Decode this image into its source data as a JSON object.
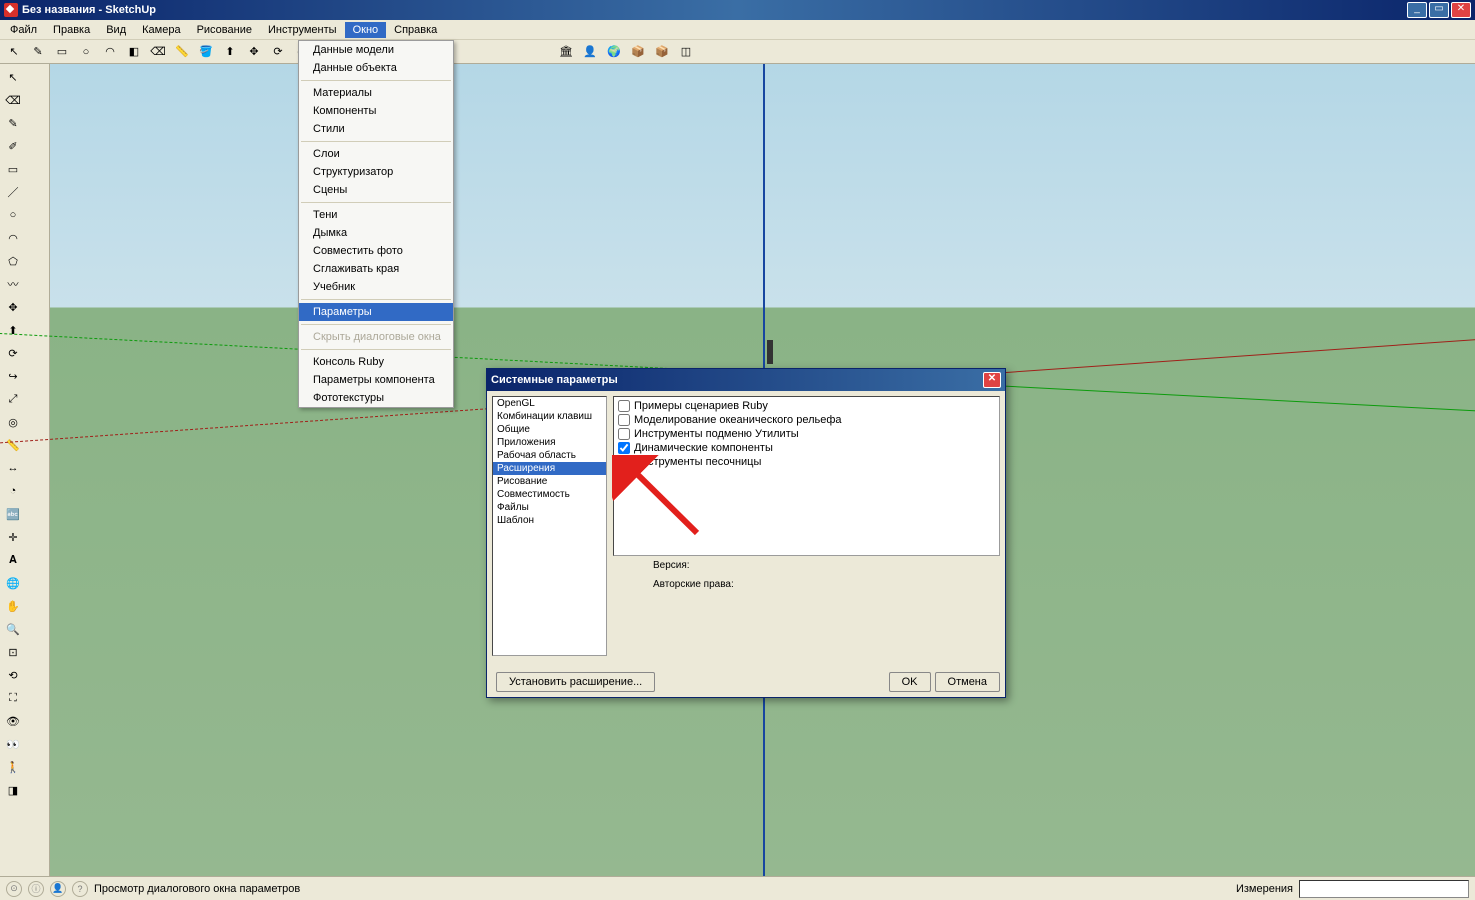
{
  "title": "Без названия - SketchUp",
  "menubar": [
    "Файл",
    "Правка",
    "Вид",
    "Камера",
    "Рисование",
    "Инструменты",
    "Окно",
    "Справка"
  ],
  "menubar_active_index": 6,
  "dropdown": {
    "groups": [
      [
        "Данные модели",
        "Данные объекта"
      ],
      [
        "Материалы",
        "Компоненты",
        "Стили"
      ],
      [
        "Слои",
        "Структуризатор",
        "Сцены"
      ],
      [
        "Тени",
        "Дымка",
        "Совместить фото",
        "Сглаживать края",
        "Учебник"
      ],
      [
        "Параметры"
      ],
      [
        "Скрыть диалоговые окна"
      ],
      [
        "Консоль Ruby",
        "Параметры компонента",
        "Фототекстуры"
      ]
    ],
    "highlight": "Параметры",
    "disabled": [
      "Скрыть диалоговые окна"
    ]
  },
  "dialog": {
    "title": "Системные параметры",
    "categories": [
      "OpenGL",
      "Комбинации клавиш",
      "Общие",
      "Приложения",
      "Рабочая область",
      "Расширения",
      "Рисование",
      "Совместимость",
      "Файлы",
      "Шаблон"
    ],
    "selected_category": "Расширения",
    "extensions": [
      {
        "label": "Примеры сценариев Ruby",
        "checked": false
      },
      {
        "label": "Моделирование океанического рельефа",
        "checked": false
      },
      {
        "label": "Инструменты подменю Утилиты",
        "checked": false
      },
      {
        "label": "Динамические компоненты",
        "checked": true
      },
      {
        "label": "Инструменты песочницы",
        "checked": true
      }
    ],
    "version_label": "Версия:",
    "author_label": "Авторские права:",
    "install_btn": "Установить расширение...",
    "ok": "OK",
    "cancel": "Отмена"
  },
  "statusbar": {
    "hint": "Просмотр диалогового окна параметров",
    "measure_label": "Измерения"
  },
  "colors": {
    "accent": "#316ac5",
    "titlebar": "#0a246a"
  }
}
